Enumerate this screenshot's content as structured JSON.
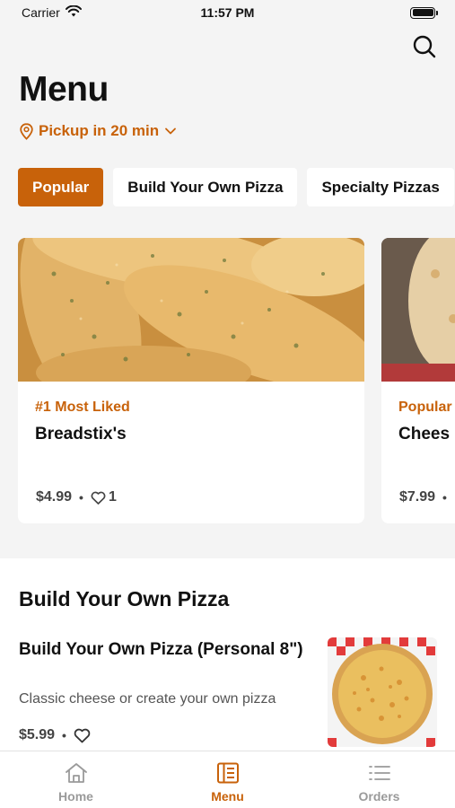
{
  "status": {
    "carrier": "Carrier",
    "time": "11:57 PM"
  },
  "header": {
    "title": "Menu",
    "pickup": "Pickup in 20 min"
  },
  "chips": [
    {
      "label": "Popular",
      "active": true
    },
    {
      "label": "Build Your Own Pizza",
      "active": false
    },
    {
      "label": "Specialty Pizzas",
      "active": false
    }
  ],
  "cards": [
    {
      "tag": "#1 Most Liked",
      "name": "Breadstix's",
      "price": "$4.99",
      "likes": "1"
    },
    {
      "tag": "Popular",
      "name": "Chees",
      "price": "$7.99"
    }
  ],
  "section": {
    "title": "Build Your Own Pizza",
    "item": {
      "name": "Build Your Own Pizza (Personal 8\")",
      "description": "Classic cheese or create your own pizza",
      "price": "$5.99"
    }
  },
  "tabs": [
    {
      "label": "Home",
      "icon": "home-icon"
    },
    {
      "label": "Menu",
      "icon": "menu-book-icon",
      "active": true
    },
    {
      "label": "Orders",
      "icon": "list-icon"
    }
  ],
  "colors": {
    "accent": "#c8620a",
    "background": "#f4f4f4"
  }
}
